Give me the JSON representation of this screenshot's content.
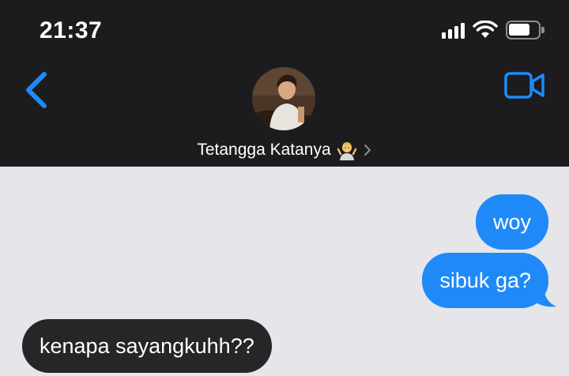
{
  "status_bar": {
    "time": "21:37",
    "icons": [
      "cellular-signal-icon",
      "wifi-icon",
      "battery-icon"
    ]
  },
  "header": {
    "back_icon": "chevron-left-icon",
    "video_icon": "video-camera-icon",
    "contact_name": "Tetangga Katanya",
    "contact_emoji": "person-shrugging-emoji",
    "disclosure_icon": "chevron-right-icon"
  },
  "messages": [
    {
      "direction": "outgoing",
      "text": "woy"
    },
    {
      "direction": "outgoing",
      "text": "sibuk ga?"
    },
    {
      "direction": "incoming",
      "text": "kenapa sayangkuhh??"
    }
  ],
  "colors": {
    "header_bg": "#1c1c1e",
    "chat_bg": "#e5e5ea",
    "outgoing_bubble": "#1f8af7",
    "incoming_bubble": "#262628",
    "accent": "#1f8af7"
  }
}
